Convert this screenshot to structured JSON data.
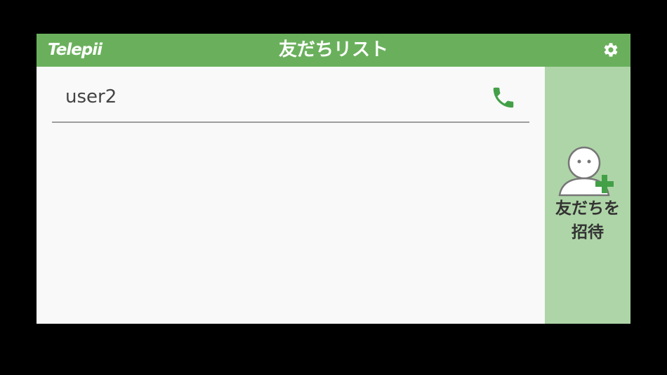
{
  "header": {
    "logo_text": "Telepii",
    "title": "友だちリスト",
    "settings_icon": "gear-icon"
  },
  "friends": [
    {
      "name": "user2",
      "action_icon": "phone-icon"
    }
  ],
  "sidebar": {
    "invite_label_line1": "友だちを",
    "invite_label_line2": "招待",
    "invite_icon": "add-person-icon"
  },
  "colors": {
    "header_bg": "#6ab05c",
    "sidebar_bg": "#aed5a7",
    "accent_green": "#43a047",
    "list_bg": "#f9f9f9"
  }
}
